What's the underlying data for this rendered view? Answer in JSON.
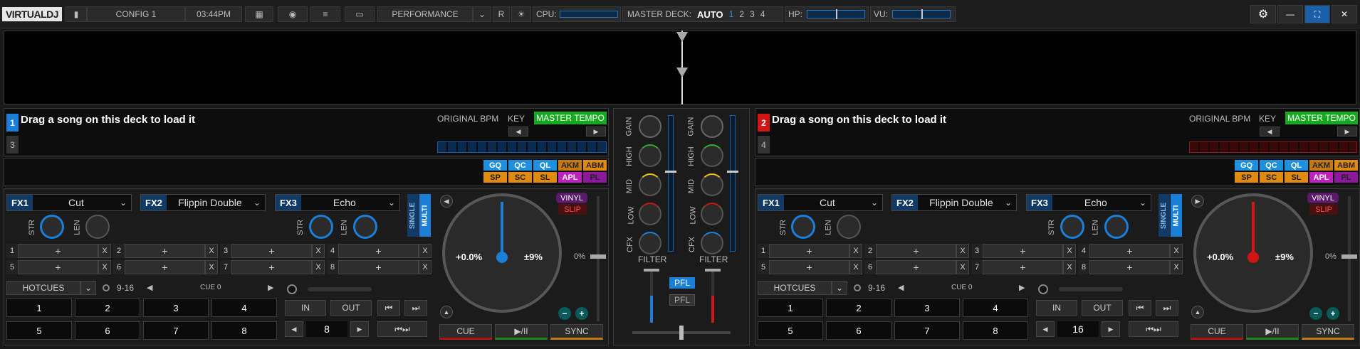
{
  "topbar": {
    "logo": "VIRTUALDJ",
    "config": "CONFIG 1",
    "time": "03:44PM",
    "layout": "PERFORMANCE",
    "r": "R",
    "cpu": "CPU:",
    "master_deck": "MASTER DECK:",
    "auto": "AUTO",
    "decks": [
      "1",
      "2",
      "3",
      "4"
    ],
    "hp": "HP:",
    "vu": "VU:"
  },
  "deck_left": {
    "num": "1",
    "num_alt": "3",
    "color": "#1a7fd9",
    "load_text": "Drag a song on this deck to load it",
    "original_bpm": "ORIGINAL BPM",
    "key": "KEY",
    "master_tempo": "MASTER TEMPO",
    "fx": [
      {
        "slot": "FX1",
        "name": "Cut"
      },
      {
        "slot": "FX2",
        "name": "Flippin Double"
      },
      {
        "slot": "FX3",
        "name": "Echo"
      }
    ],
    "str": "STR",
    "len": "LEN",
    "single": "SINGLE",
    "multi": "MULTI",
    "samplers": [
      {
        "n": "1",
        "v": "+"
      },
      {
        "n": "2",
        "v": "+"
      },
      {
        "n": "3",
        "v": "+"
      },
      {
        "n": "4",
        "v": "+"
      },
      {
        "n": "5",
        "v": "+"
      },
      {
        "n": "6",
        "v": "+"
      },
      {
        "n": "7",
        "v": "+"
      },
      {
        "n": "8",
        "v": "+"
      }
    ],
    "x": "X",
    "hotcues": "HOTCUES",
    "range": "9-16",
    "cue_label": "CUE 0",
    "pads": [
      "1",
      "2",
      "3",
      "4",
      "5",
      "6",
      "7",
      "8"
    ],
    "in": "IN",
    "out": "OUT",
    "loop_size": "8",
    "vinyl": "VINYL",
    "slip": "SLIP",
    "pitch": "+0.0%",
    "range_pct": "±9%",
    "pitch_val": "0%",
    "cue": "CUE",
    "play": "▶/II",
    "sync": "SYNC"
  },
  "deck_right": {
    "num": "2",
    "num_alt": "4",
    "color": "#d01515",
    "load_text": "Drag a song on this deck to load it",
    "original_bpm": "ORIGINAL BPM",
    "key": "KEY",
    "master_tempo": "MASTER TEMPO",
    "fx": [
      {
        "slot": "FX1",
        "name": "Cut"
      },
      {
        "slot": "FX2",
        "name": "Flippin Double"
      },
      {
        "slot": "FX3",
        "name": "Echo"
      }
    ],
    "str": "STR",
    "len": "LEN",
    "single": "SINGLE",
    "multi": "MULTI",
    "samplers": [
      {
        "n": "1",
        "v": "+"
      },
      {
        "n": "2",
        "v": "+"
      },
      {
        "n": "3",
        "v": "+"
      },
      {
        "n": "4",
        "v": "+"
      },
      {
        "n": "5",
        "v": "+"
      },
      {
        "n": "6",
        "v": "+"
      },
      {
        "n": "7",
        "v": "+"
      },
      {
        "n": "8",
        "v": "+"
      }
    ],
    "x": "X",
    "hotcues": "HOTCUES",
    "range": "9-16",
    "cue_label": "CUE 0",
    "pads": [
      "1",
      "2",
      "3",
      "4",
      "5",
      "6",
      "7",
      "8"
    ],
    "in": "IN",
    "out": "OUT",
    "loop_size": "16",
    "vinyl": "VINYL",
    "slip": "SLIP",
    "pitch": "+0.0%",
    "range_pct": "±9%",
    "pitch_val": "0%",
    "cue": "CUE",
    "play": "▶/II",
    "sync": "SYNC"
  },
  "keytags": {
    "row1": [
      {
        "t": "GQ",
        "c": "#1e90e0"
      },
      {
        "t": "QC",
        "c": "#1e90e0"
      },
      {
        "t": "QL",
        "c": "#1e90e0"
      },
      {
        "t": "AKM",
        "c": "#c47a10"
      },
      {
        "t": "ABM",
        "c": "#e08a10"
      }
    ],
    "row2": [
      {
        "t": "SP",
        "c": "#e08a10"
      },
      {
        "t": "SC",
        "c": "#e08a10"
      },
      {
        "t": "SL",
        "c": "#e08a10"
      },
      {
        "t": "APL",
        "c": "#c020c0"
      },
      {
        "t": "PL",
        "c": "#8a1a9a"
      }
    ]
  },
  "mixer": {
    "labels": [
      "GAIN",
      "HIGH",
      "MID",
      "LOW",
      "CFX"
    ],
    "filter": "FILTER",
    "pfl": "PFL"
  }
}
